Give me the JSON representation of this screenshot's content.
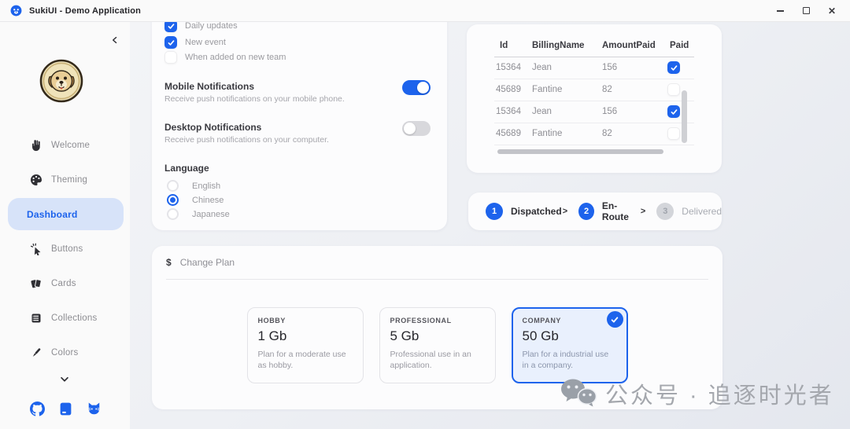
{
  "titlebar": {
    "title": "SukiUI - Demo Application"
  },
  "sidebar": {
    "items": [
      {
        "label": "Welcome"
      },
      {
        "label": "Theming"
      },
      {
        "label": "Dashboard",
        "active": true
      },
      {
        "label": "Buttons"
      },
      {
        "label": "Cards"
      },
      {
        "label": "Collections"
      },
      {
        "label": "Colors"
      }
    ]
  },
  "settings": {
    "checkboxes": [
      {
        "label": "Daily updates",
        "checked": true
      },
      {
        "label": "New event",
        "checked": true
      },
      {
        "label": "When added on new team",
        "checked": false
      }
    ],
    "mobile": {
      "title": "Mobile Notifications",
      "desc": "Receive push notifications on your mobile phone.",
      "enabled": true
    },
    "desktop": {
      "title": "Desktop Notifications",
      "desc": "Receive push notifications on your computer.",
      "enabled": false
    },
    "language": {
      "label": "Language",
      "options": [
        {
          "label": "English",
          "selected": false
        },
        {
          "label": "Chinese",
          "selected": true
        },
        {
          "label": "Japanese",
          "selected": false
        }
      ]
    }
  },
  "invoices": {
    "columns": [
      "Id",
      "BillingName",
      "AmountPaid",
      "Paid"
    ],
    "rows": [
      {
        "id": "15364",
        "billing_name": "Jean",
        "amount_paid": "156",
        "paid": true
      },
      {
        "id": "45689",
        "billing_name": "Fantine",
        "amount_paid": "82",
        "paid": false
      },
      {
        "id": "15364",
        "billing_name": "Jean",
        "amount_paid": "156",
        "paid": true
      },
      {
        "id": "45689",
        "billing_name": "Fantine",
        "amount_paid": "82",
        "paid": false
      }
    ]
  },
  "stepper": {
    "steps": [
      {
        "number": "1",
        "label": "Dispatched",
        "arrow": ">",
        "state": "active"
      },
      {
        "number": "2",
        "label": "En-Route",
        "arrow": ">",
        "state": "active"
      },
      {
        "number": "3",
        "label": "Delivered",
        "arrow": "",
        "state": "upcoming"
      }
    ]
  },
  "plans": {
    "currency_icon": "$",
    "title": "Change Plan",
    "options": [
      {
        "tier": "HOBBY",
        "size": "1 Gb",
        "desc": "Plan for a moderate use as hobby.",
        "selected": false
      },
      {
        "tier": "PROFESSIONAL",
        "size": "5 Gb",
        "desc": "Professional use in an application.",
        "selected": false
      },
      {
        "tier": "COMPANY",
        "size": "50 Gb",
        "desc": "Plan for a industrial use in a company.",
        "selected": true
      }
    ]
  },
  "watermark": {
    "text": "公众号 · 追逐时光者"
  },
  "colors": {
    "accent": "#1d63ec",
    "accent_light": "#d7e3f9",
    "toggle_off": "#d8d8dc"
  }
}
